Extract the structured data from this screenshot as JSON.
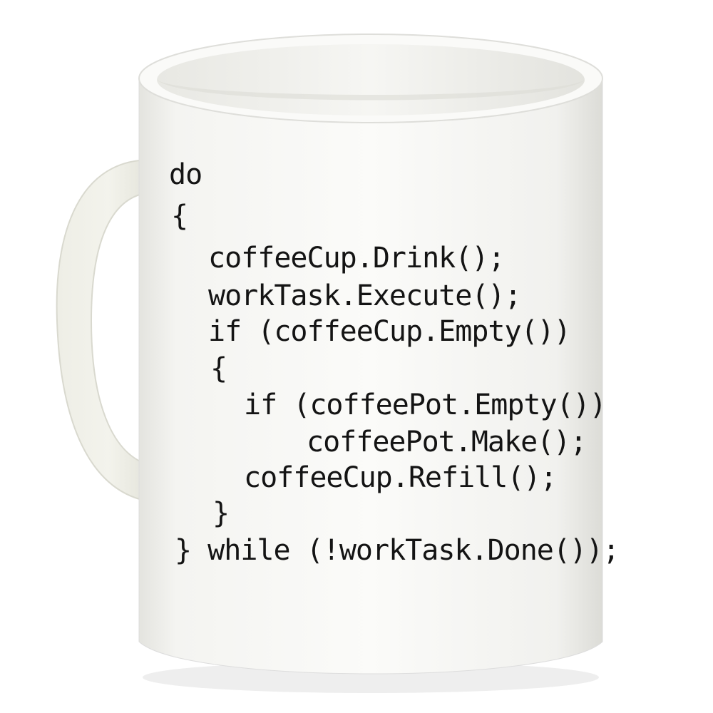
{
  "mug": {
    "body_color": "#f3f3f0",
    "ink_color": "#141414"
  },
  "code": {
    "lines": [
      "do",
      "{",
      "coffeeCup.Drink();",
      "workTask.Execute();",
      "if (coffeeCup.Empty())",
      "{",
      "if (coffeePot.Empty())",
      "coffeePot.Make();",
      "coffeeCup.Refill();",
      "}",
      "} while (!workTask.Done());"
    ]
  }
}
